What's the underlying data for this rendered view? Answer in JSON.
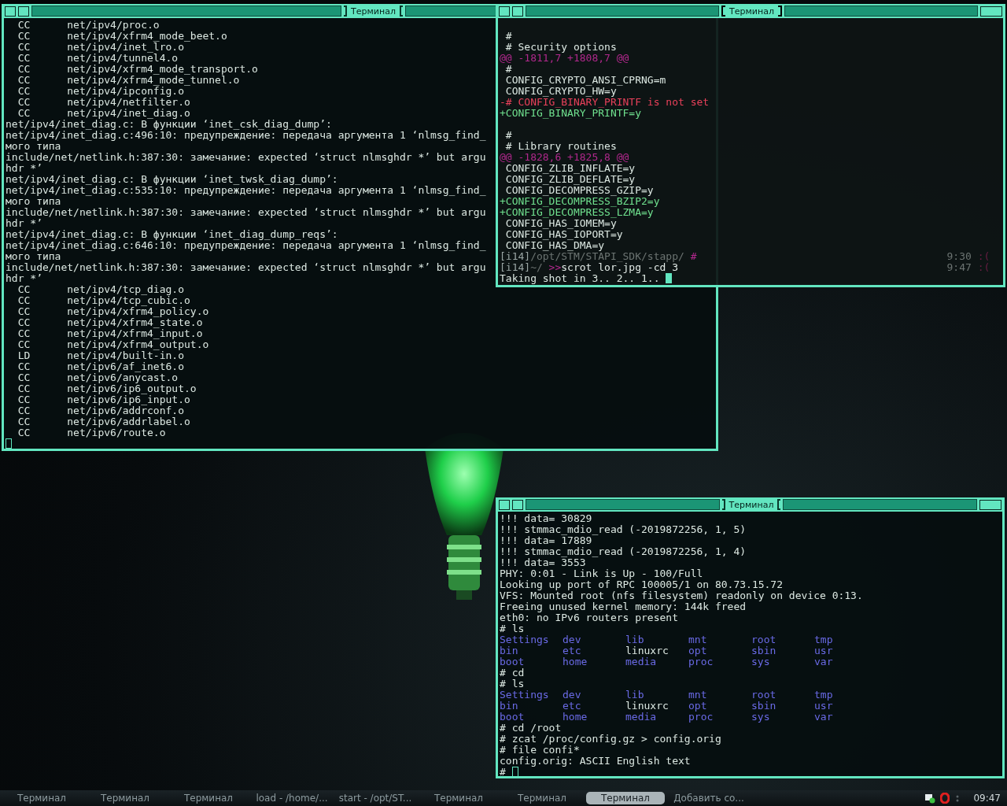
{
  "windows": [
    {
      "title": "Терминал",
      "active": false,
      "lines": [
        {
          "kind": "plain",
          "text": "  CC      net/ipv4/proc.o"
        },
        {
          "kind": "plain",
          "text": "  CC      net/ipv4/xfrm4_mode_beet.o"
        },
        {
          "kind": "plain",
          "text": "  CC      net/ipv4/inet_lro.o"
        },
        {
          "kind": "plain",
          "text": "  CC      net/ipv4/tunnel4.o"
        },
        {
          "kind": "plain",
          "text": "  CC      net/ipv4/xfrm4_mode_transport.o"
        },
        {
          "kind": "plain",
          "text": "  CC      net/ipv4/xfrm4_mode_tunnel.o"
        },
        {
          "kind": "plain",
          "text": "  CC      net/ipv4/ipconfig.o"
        },
        {
          "kind": "plain",
          "text": "  CC      net/ipv4/netfilter.o"
        },
        {
          "kind": "plain",
          "text": "  CC      net/ipv4/inet_diag.o"
        },
        {
          "kind": "plain",
          "text": "net/ipv4/inet_diag.c: В функции ‘inet_csk_diag_dump’:"
        },
        {
          "kind": "plain",
          "text": "net/ipv4/inet_diag.c:496:10: предупреждение: передача аргумента 1 ‘nlmsg_find_"
        },
        {
          "kind": "plain",
          "text": "мого типа"
        },
        {
          "kind": "plain",
          "text": "include/net/netlink.h:387:30: замечание: expected ‘struct nlmsghdr *’ but argu"
        },
        {
          "kind": "plain",
          "text": "hdr *’"
        },
        {
          "kind": "plain",
          "text": "net/ipv4/inet_diag.c: В функции ‘inet_twsk_diag_dump’:"
        },
        {
          "kind": "plain",
          "text": "net/ipv4/inet_diag.c:535:10: предупреждение: передача аргумента 1 ‘nlmsg_find_"
        },
        {
          "kind": "plain",
          "text": "мого типа"
        },
        {
          "kind": "plain",
          "text": "include/net/netlink.h:387:30: замечание: expected ‘struct nlmsghdr *’ but argu"
        },
        {
          "kind": "plain",
          "text": "hdr *’"
        },
        {
          "kind": "plain",
          "text": "net/ipv4/inet_diag.c: В функции ‘inet_diag_dump_reqs’:"
        },
        {
          "kind": "plain",
          "text": "net/ipv4/inet_diag.c:646:10: предупреждение: передача аргумента 1 ‘nlmsg_find_"
        },
        {
          "kind": "plain",
          "text": "мого типа"
        },
        {
          "kind": "plain",
          "text": "include/net/netlink.h:387:30: замечание: expected ‘struct nlmsghdr *’ but argu"
        },
        {
          "kind": "plain",
          "text": "hdr *’"
        },
        {
          "kind": "plain",
          "text": "  CC      net/ipv4/tcp_diag.o"
        },
        {
          "kind": "plain",
          "text": "  CC      net/ipv4/tcp_cubic.o"
        },
        {
          "kind": "plain",
          "text": "  CC      net/ipv4/xfrm4_policy.o"
        },
        {
          "kind": "plain",
          "text": "  CC      net/ipv4/xfrm4_state.o"
        },
        {
          "kind": "plain",
          "text": "  CC      net/ipv4/xfrm4_input.o"
        },
        {
          "kind": "plain",
          "text": "  CC      net/ipv4/xfrm4_output.o"
        },
        {
          "kind": "plain",
          "text": "  LD      net/ipv4/built-in.o"
        },
        {
          "kind": "plain",
          "text": "  CC      net/ipv6/af_inet6.o"
        },
        {
          "kind": "plain",
          "text": "  CC      net/ipv6/anycast.o"
        },
        {
          "kind": "plain",
          "text": "  CC      net/ipv6/ip6_output.o"
        },
        {
          "kind": "plain",
          "text": "  CC      net/ipv6/ip6_input.o"
        },
        {
          "kind": "plain",
          "text": "  CC      net/ipv6/addrconf.o"
        },
        {
          "kind": "plain",
          "text": "  CC      net/ipv6/addrlabel.o"
        },
        {
          "kind": "plain",
          "text": "  CC      net/ipv6/route.o"
        },
        {
          "kind": "input",
          "cursor": true
        }
      ]
    },
    {
      "title": "Терминал",
      "active": true,
      "lines": [
        {
          "kind": "plain",
          "text": " #",
          "gap_before": true
        },
        {
          "kind": "plain",
          "text": " # Security options"
        },
        {
          "kind": "hunk",
          "text": "@@ -1811,7 +1808,7 @@"
        },
        {
          "kind": "plain",
          "text": " #"
        },
        {
          "kind": "plain",
          "text": " CONFIG_CRYPTO_ANSI_CPRNG=m"
        },
        {
          "kind": "plain",
          "text": " CONFIG_CRYPTO_HW=y"
        },
        {
          "kind": "removed",
          "text": "-# CONFIG_BINARY_PRINTF is not set"
        },
        {
          "kind": "added",
          "text": "+CONFIG_BINARY_PRINTF=y"
        },
        {
          "kind": "plain",
          "text": " #",
          "gap_before": true
        },
        {
          "kind": "plain",
          "text": " # Library routines"
        },
        {
          "kind": "hunk",
          "text": "@@ -1828,6 +1825,8 @@"
        },
        {
          "kind": "plain",
          "text": " CONFIG_ZLIB_INFLATE=y"
        },
        {
          "kind": "plain",
          "text": " CONFIG_ZLIB_DEFLATE=y"
        },
        {
          "kind": "plain",
          "text": " CONFIG_DECOMPRESS_GZIP=y"
        },
        {
          "kind": "added",
          "text": "+CONFIG_DECOMPRESS_BZIP2=y"
        },
        {
          "kind": "added",
          "text": "+CONFIG_DECOMPRESS_LZMA=y"
        },
        {
          "kind": "plain",
          "text": " CONFIG_HAS_IOMEM=y"
        },
        {
          "kind": "plain",
          "text": " CONFIG_HAS_IOPORT=y"
        },
        {
          "kind": "plain",
          "text": " CONFIG_HAS_DMA=y"
        },
        {
          "kind": "prompt",
          "host": "[i14]",
          "path": "/opt/STM/STAPI_SDK/stapp/",
          "sign": " #",
          "time": "9:30",
          "mood": ":("
        },
        {
          "kind": "prompt",
          "host": "[i14]",
          "path": "~/",
          "sign": " >>",
          "command": "scrot lor.jpg -cd 3",
          "time": "9:47",
          "mood": ":("
        },
        {
          "kind": "plain",
          "text": "Taking shot in 3.. 2.. 1.. ",
          "cursor": true
        }
      ]
    },
    {
      "title": "Терминал",
      "active": false,
      "lines": [
        {
          "kind": "plain",
          "text": "!!! data= 30829"
        },
        {
          "kind": "plain",
          "text": "!!! stmmac_mdio_read (-2019872256, 1, 5)"
        },
        {
          "kind": "plain",
          "text": "!!! data= 17889"
        },
        {
          "kind": "plain",
          "text": "!!! stmmac_mdio_read (-2019872256, 1, 4)"
        },
        {
          "kind": "plain",
          "text": "!!! data= 3553"
        },
        {
          "kind": "plain",
          "text": "PHY: 0:01 - Link is Up - 100/Full"
        },
        {
          "kind": "plain",
          "text": "Looking up port of RPC 100005/1 on 80.73.15.72"
        },
        {
          "kind": "plain",
          "text": "VFS: Mounted root (nfs filesystem) readonly on device 0:13."
        },
        {
          "kind": "plain",
          "text": "Freeing unused kernel memory: 144k freed"
        },
        {
          "kind": "plain",
          "text": "eth0: no IPv6 routers present"
        },
        {
          "kind": "plain",
          "text": "# ls"
        },
        {
          "kind": "listing",
          "entries": [
            {
              "name": "Settings",
              "directory": true
            },
            {
              "name": "dev",
              "directory": true
            },
            {
              "name": "lib",
              "directory": true
            },
            {
              "name": "mnt",
              "directory": true
            },
            {
              "name": "root",
              "directory": true
            },
            {
              "name": "tmp",
              "directory": true
            }
          ]
        },
        {
          "kind": "listing",
          "entries": [
            {
              "name": "bin",
              "directory": true
            },
            {
              "name": "etc",
              "directory": true
            },
            {
              "name": "linuxrc",
              "directory": false
            },
            {
              "name": "opt",
              "directory": true
            },
            {
              "name": "sbin",
              "directory": true
            },
            {
              "name": "usr",
              "directory": true
            }
          ]
        },
        {
          "kind": "listing",
          "entries": [
            {
              "name": "boot",
              "directory": true
            },
            {
              "name": "home",
              "directory": true
            },
            {
              "name": "media",
              "directory": true
            },
            {
              "name": "proc",
              "directory": true
            },
            {
              "name": "sys",
              "directory": true
            },
            {
              "name": "var",
              "directory": true
            }
          ]
        },
        {
          "kind": "plain",
          "text": "# cd"
        },
        {
          "kind": "plain",
          "text": "# ls"
        },
        {
          "kind": "listing",
          "entries": [
            {
              "name": "Settings",
              "directory": true
            },
            {
              "name": "dev",
              "directory": true
            },
            {
              "name": "lib",
              "directory": true
            },
            {
              "name": "mnt",
              "directory": true
            },
            {
              "name": "root",
              "directory": true
            },
            {
              "name": "tmp",
              "directory": true
            }
          ]
        },
        {
          "kind": "listing",
          "entries": [
            {
              "name": "bin",
              "directory": true
            },
            {
              "name": "etc",
              "directory": true
            },
            {
              "name": "linuxrc",
              "directory": false
            },
            {
              "name": "opt",
              "directory": true
            },
            {
              "name": "sbin",
              "directory": true
            },
            {
              "name": "usr",
              "directory": true
            }
          ]
        },
        {
          "kind": "listing",
          "entries": [
            {
              "name": "boot",
              "directory": true
            },
            {
              "name": "home",
              "directory": true
            },
            {
              "name": "media",
              "directory": true
            },
            {
              "name": "proc",
              "directory": true
            },
            {
              "name": "sys",
              "directory": true
            },
            {
              "name": "var",
              "directory": true
            }
          ]
        },
        {
          "kind": "plain",
          "text": "# cd /root"
        },
        {
          "kind": "plain",
          "text": "# zcat /proc/config.gz > config.orig"
        },
        {
          "kind": "plain",
          "text": "# file confi*"
        },
        {
          "kind": "plain",
          "text": "config.orig: ASCII English text"
        },
        {
          "kind": "plain",
          "text": "# ",
          "cursor": true
        }
      ]
    }
  ],
  "taskbar": {
    "items": [
      {
        "label": "Терминал",
        "selected": false
      },
      {
        "label": "Терминал",
        "selected": false
      },
      {
        "label": "Терминал",
        "selected": false
      },
      {
        "label": "load - /home/...",
        "selected": false
      },
      {
        "label": "start - /opt/ST...",
        "selected": false
      },
      {
        "label": "Терминал",
        "selected": false
      },
      {
        "label": "Терминал",
        "selected": false
      },
      {
        "label": "Терминал",
        "selected": true
      },
      {
        "label": "Добавить со...",
        "selected": false
      }
    ],
    "clock": "09:47"
  }
}
